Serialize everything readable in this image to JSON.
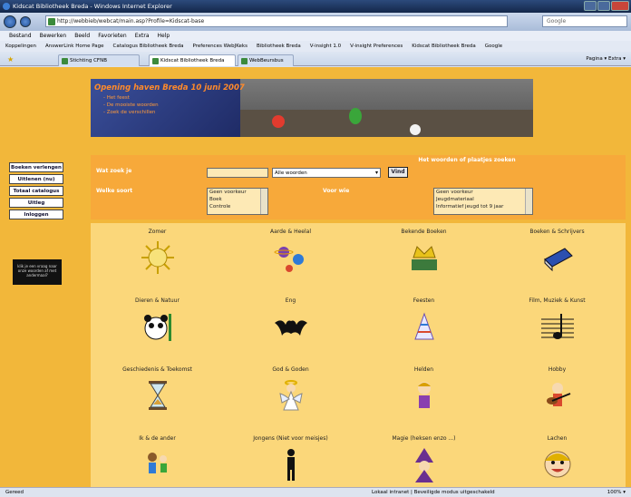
{
  "window": {
    "title": "Kidscat Bibliotheek Breda - Windows Internet Explorer",
    "url": "http://webbieb/webcat/main.asp?Profile=Kidscat-base",
    "search_placeholder": "Google"
  },
  "menu": [
    "Bestand",
    "Bewerken",
    "Beeld",
    "Favorieten",
    "Extra",
    "Help"
  ],
  "links": [
    "Koppelingen",
    "AnswerLink Home Page",
    "Catalogus Bibliotheek Breda",
    "Preferences WebJKeks",
    "Bibliotheek Breda",
    "V-insight 1.0",
    "V-insight Preferences",
    "Kidscat Bibliotheek Breda",
    "Google"
  ],
  "tabs": [
    "Stichting CFNB",
    "Kidscat Bibliotheek Breda",
    "WebBeursbus"
  ],
  "tools": "Pagina ▾   Extra ▾",
  "banner": {
    "title": "Opening haven Breda 10 juni 2007",
    "items": [
      "Het feest",
      "De mooiste woorden",
      "Zoek de verschillen"
    ]
  },
  "sidebar": {
    "buttons": [
      "Boeken verlengen",
      "Uitlenen (nu)",
      "Totaal catalogus",
      "Uitleg",
      "Inloggen"
    ],
    "panel": "klik je een vraag naar onze woorden af met andermaal?"
  },
  "search": {
    "heading": "Het woorden of plaatjes zoeken",
    "label_what": "Wat zoek je",
    "dropdown": "Alle woorden",
    "go": "Vind",
    "label_type": "Welke soort",
    "label_age": "Voor wie",
    "list1": [
      "Geen voorkeur",
      "Boek",
      "Controle"
    ],
    "list2": [
      "Geen voorkeur",
      "Jeugdmateriaal",
      "Informatief jeugd tot 9 jaar"
    ]
  },
  "categories": [
    "Zomer",
    "Aarde & Heelal",
    "Bekende Boeken",
    "Boeken & Schrijvers",
    "Dieren & Natuur",
    "Eng",
    "Feesten",
    "Film, Muziek & Kunst",
    "Geschiedenis & Toekomst",
    "God & Goden",
    "Helden",
    "Hobby",
    "Ik & de ander",
    "Jongens (Niet voor meisjes)",
    "Magie (heksen enzo ...)",
    "Lachen"
  ],
  "status": {
    "left": "Gereed",
    "zone": "Lokaal intranet | Beveiligde modus uitgeschakeld",
    "zoom": "100% ▾"
  },
  "colors": {
    "page_bg": "#f2b73a",
    "search_bg": "#f7a93a",
    "grid_bg": "#fbd77a",
    "banner_title": "#ff8a2a"
  }
}
